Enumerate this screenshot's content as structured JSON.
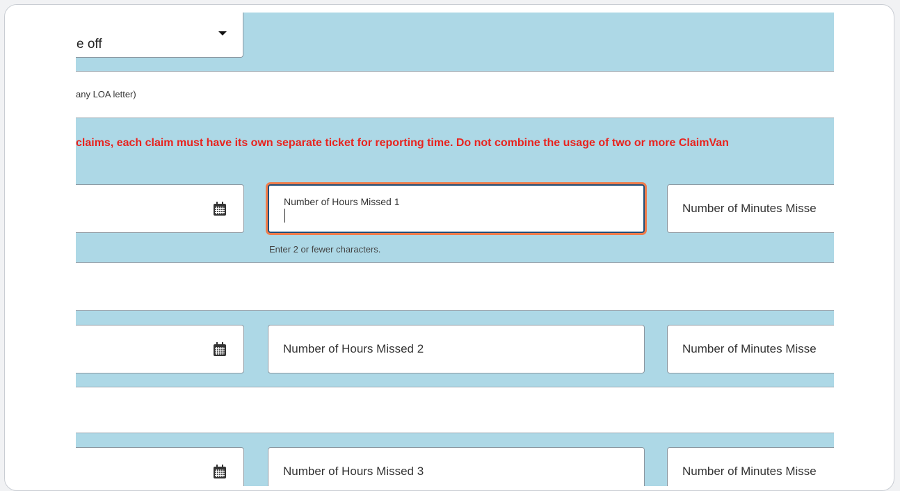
{
  "form": {
    "leave_type_value": "e off",
    "loa_note": "any LOA letter)",
    "warning_text": "claims, each claim must have its own separate ticket for reporting time. Do not combine the usage of two or more ClaimVan",
    "rows": [
      {
        "hours_label": "Number of Hours Missed 1",
        "minutes_label": "Number of Minutes Misse",
        "hours_hint": "Enter 2 or fewer characters."
      },
      {
        "hours_label": "Number of Hours Missed 2",
        "minutes_label": "Number of Minutes Misse"
      },
      {
        "hours_label": "Number of Hours Missed 3",
        "minutes_label": "Number of Minutes Misse"
      }
    ]
  },
  "icons": {
    "date_picker": "calendar-icon",
    "dropdown": "caret-down-icon"
  },
  "colors": {
    "section_background": "#add8e6",
    "warning_text": "#e8231e",
    "focus_ring": "#ef7c4b",
    "focus_border": "#1f4e79"
  }
}
